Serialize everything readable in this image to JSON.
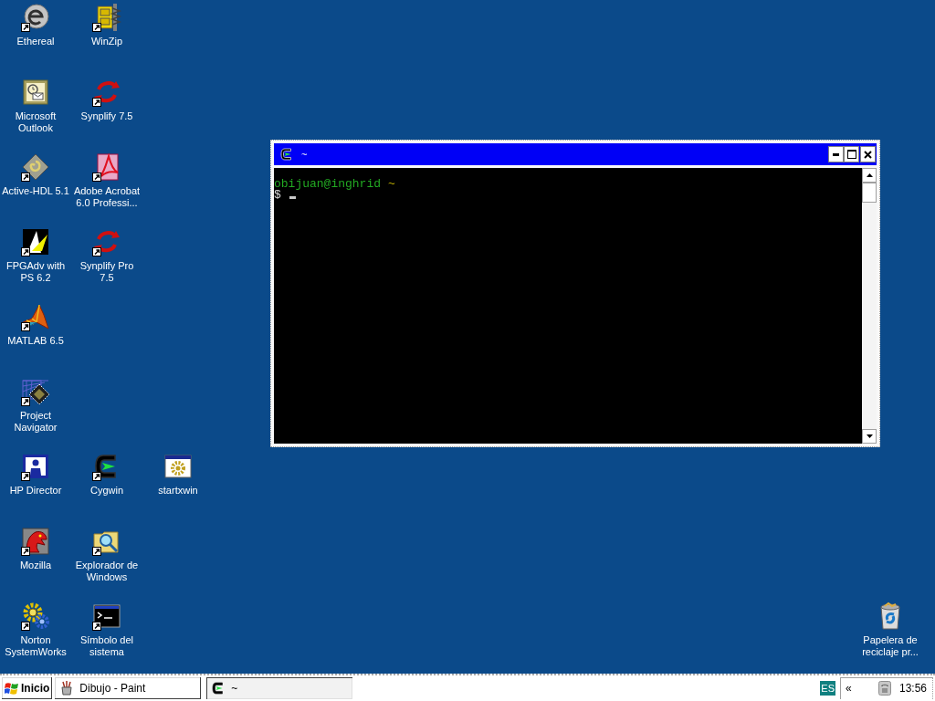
{
  "desktop": {
    "icon_rows": [
      [
        {
          "label": "Ethereal",
          "kind": "disc",
          "shortcut": true
        },
        {
          "label": "WinZip",
          "kind": "cabinet",
          "shortcut": true
        }
      ],
      [
        {
          "label": "Microsoft Outlook",
          "kind": "mail",
          "shortcut": false
        },
        {
          "label": "Synplify 7.5",
          "kind": "arrows",
          "shortcut": true
        }
      ],
      [
        {
          "label": "Active-HDL 5.1",
          "kind": "diamond",
          "shortcut": true
        },
        {
          "label": "Adobe Acrobat 6.0 Professi...",
          "kind": "document",
          "shortcut": true
        }
      ],
      [
        {
          "label": "FPGAdv with PS 6.2",
          "kind": "sail",
          "shortcut": true
        },
        {
          "label": "Synplify Pro 7.5",
          "kind": "arrows",
          "shortcut": true
        }
      ],
      [
        {
          "label": "MATLAB 6.5",
          "kind": "peak",
          "shortcut": true
        }
      ],
      [
        {
          "label": "Project Navigator",
          "kind": "chip",
          "shortcut": true
        }
      ],
      [
        {
          "label": "HP Director",
          "kind": "portrait",
          "shortcut": true
        },
        {
          "label": "Cygwin",
          "kind": "prompt",
          "shortcut": true
        },
        {
          "label": "startxwin",
          "kind": "window",
          "shortcut": false
        }
      ],
      [
        {
          "label": "Mozilla",
          "kind": "dragon",
          "shortcut": true
        },
        {
          "label": "Explorador de Windows",
          "kind": "folder",
          "shortcut": true
        }
      ],
      [
        {
          "label": "Norton SystemWorks",
          "kind": "gears",
          "shortcut": true
        },
        {
          "label": "Símbolo del sistema",
          "kind": "console",
          "shortcut": true
        }
      ]
    ],
    "recycle_bin": {
      "label": "Papelera de reciclaje pr..."
    }
  },
  "terminal_window": {
    "title": "~",
    "lines": [
      {
        "segments": [
          {
            "text": "obijuan@inghrid",
            "kind": "user"
          },
          {
            "text": "~",
            "kind": "path"
          }
        ]
      },
      {
        "segments": [
          {
            "text": "$",
            "kind": "prompt"
          }
        ]
      }
    ],
    "cursor": true
  },
  "taskbar": {
    "start_button": {
      "label": "Inicio"
    },
    "tasks": [
      {
        "label": "Dibujo - Paint",
        "kind": "paint",
        "selected": false
      },
      {
        "label": "~",
        "kind": "terminal",
        "selected": true
      }
    ],
    "language": "ES",
    "tray_toggle": "«",
    "clock": "13:56"
  }
}
